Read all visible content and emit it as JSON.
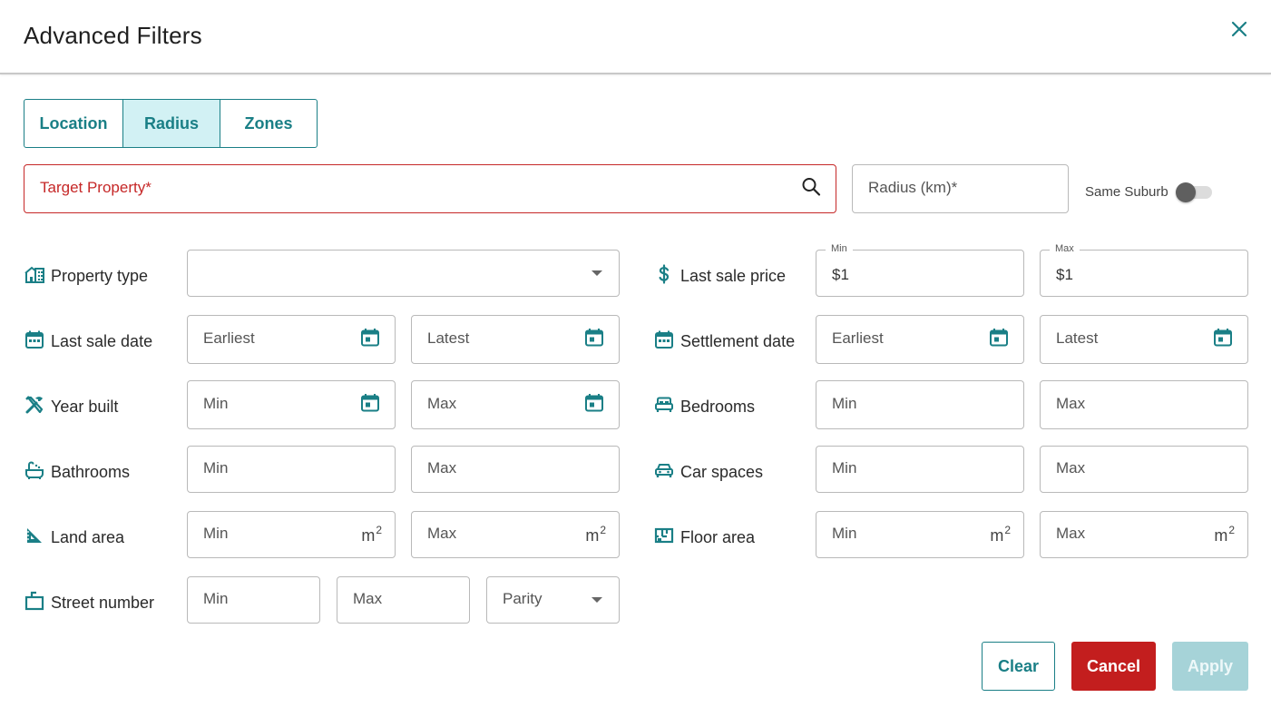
{
  "dialog": {
    "title": "Advanced Filters"
  },
  "tabs": [
    {
      "label": "Location",
      "active": false
    },
    {
      "label": "Radius",
      "active": true
    },
    {
      "label": "Zones",
      "active": false
    }
  ],
  "search": {
    "target_placeholder": "Target Property*",
    "radius_placeholder": "Radius (km)*",
    "same_suburb_label": "Same Suburb",
    "same_suburb_on": false
  },
  "filters": {
    "property_type": {
      "label": "Property type",
      "value": ""
    },
    "last_sale_price": {
      "label": "Last sale price",
      "min_legend": "Min",
      "max_legend": "Max",
      "min_value": "$1",
      "max_value": "$1"
    },
    "last_sale_date": {
      "label": "Last sale date",
      "earliest": "Earliest",
      "latest": "Latest"
    },
    "settlement_date": {
      "label": "Settlement date",
      "earliest": "Earliest",
      "latest": "Latest"
    },
    "year_built": {
      "label": "Year built",
      "min": "Min",
      "max": "Max"
    },
    "bedrooms": {
      "label": "Bedrooms",
      "min": "Min",
      "max": "Max"
    },
    "bathrooms": {
      "label": "Bathrooms",
      "min": "Min",
      "max": "Max"
    },
    "car_spaces": {
      "label": "Car spaces",
      "min": "Min",
      "max": "Max"
    },
    "land_area": {
      "label": "Land area",
      "min": "Min",
      "max": "Max",
      "unit": "m",
      "unit_exp": "2"
    },
    "floor_area": {
      "label": "Floor area",
      "min": "Min",
      "max": "Max",
      "unit": "m",
      "unit_exp": "2"
    },
    "street_number": {
      "label": "Street number",
      "min": "Min",
      "max": "Max",
      "parity": "Parity"
    }
  },
  "actions": {
    "clear": "Clear",
    "cancel": "Cancel",
    "apply": "Apply"
  },
  "colors": {
    "accent": "#1a7f86",
    "error": "#c62828",
    "cancel": "#c31e1e",
    "apply_disabled": "#a6d3d8",
    "tab_active_bg": "#d2f1f4"
  },
  "icons": [
    "close-icon",
    "search-icon",
    "building-icon",
    "dollar-icon",
    "calendar-icon",
    "tools-icon",
    "bed-icon",
    "bathtub-icon",
    "car-icon",
    "set-square-icon",
    "floor-plan-icon",
    "street-number-icon",
    "chevron-down-icon"
  ]
}
